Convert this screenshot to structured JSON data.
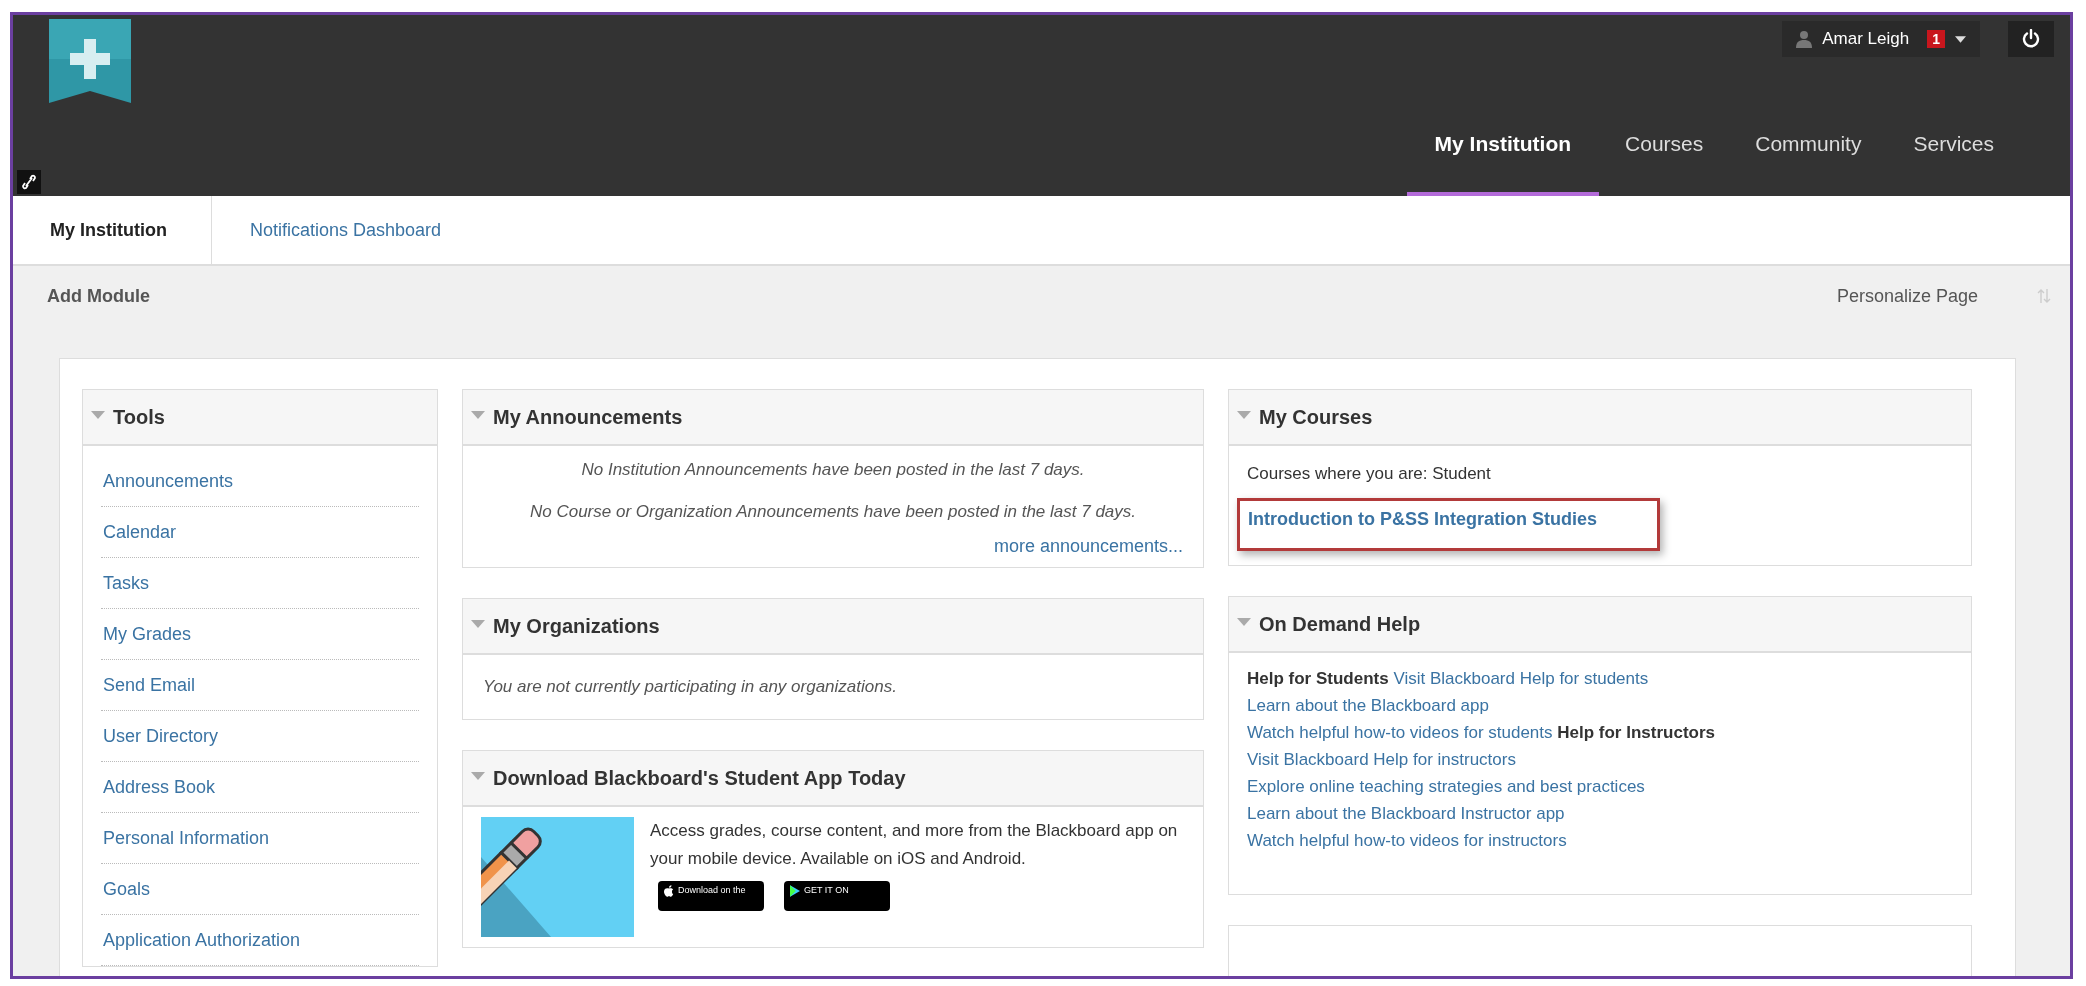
{
  "header": {
    "user_name": "Amar Leigh",
    "notification_count": "1",
    "nav": [
      {
        "label": "My Institution",
        "selected": true
      },
      {
        "label": "Courses",
        "selected": false
      },
      {
        "label": "Community",
        "selected": false
      },
      {
        "label": "Services",
        "selected": false
      }
    ]
  },
  "subnav": [
    {
      "label": "My Institution",
      "selected": true
    },
    {
      "label": "Notifications Dashboard",
      "selected": false
    }
  ],
  "toolbar": {
    "add_module": "Add Module",
    "personalize": "Personalize Page"
  },
  "tools": {
    "title": "Tools",
    "items": [
      "Announcements",
      "Calendar",
      "Tasks",
      "My Grades",
      "Send Email",
      "User Directory",
      "Address Book",
      "Personal Information",
      "Goals",
      "Application Authorization"
    ]
  },
  "announcements": {
    "title": "My Announcements",
    "messages": [
      "No Institution Announcements have been posted in the last 7 days.",
      "No Course or Organization Announcements have been posted in the last 7 days."
    ],
    "more": "more announcements..."
  },
  "organizations": {
    "title": "My Organizations",
    "message": "You are not currently participating in any organizations."
  },
  "app_promo": {
    "title": "Download Blackboard's Student App Today",
    "description": "Access grades, course content, and more from the Blackboard app on your mobile device. Available on iOS and Android.",
    "badges": [
      {
        "kind": "apple",
        "label": "Download on the"
      },
      {
        "kind": "google",
        "label": "GET IT ON"
      }
    ]
  },
  "courses": {
    "title": "My Courses",
    "role_line": "Courses where you are: Student",
    "items": [
      {
        "name": "Introduction to P&SS Integration Studies",
        "highlighted": true
      }
    ]
  },
  "help": {
    "title": "On Demand Help",
    "groups": [
      {
        "heading": "Help for Students",
        "links": [
          "Visit Blackboard Help for students",
          "Learn about the Blackboard app",
          "Watch helpful how-to videos for students"
        ]
      },
      {
        "heading": "Help for Instructors",
        "links": [
          "Visit Blackboard Help for instructors",
          "Explore online teaching strategies and best practices",
          "Learn about the Blackboard Instructor app",
          "Watch helpful how-to videos for instructors"
        ]
      }
    ]
  }
}
